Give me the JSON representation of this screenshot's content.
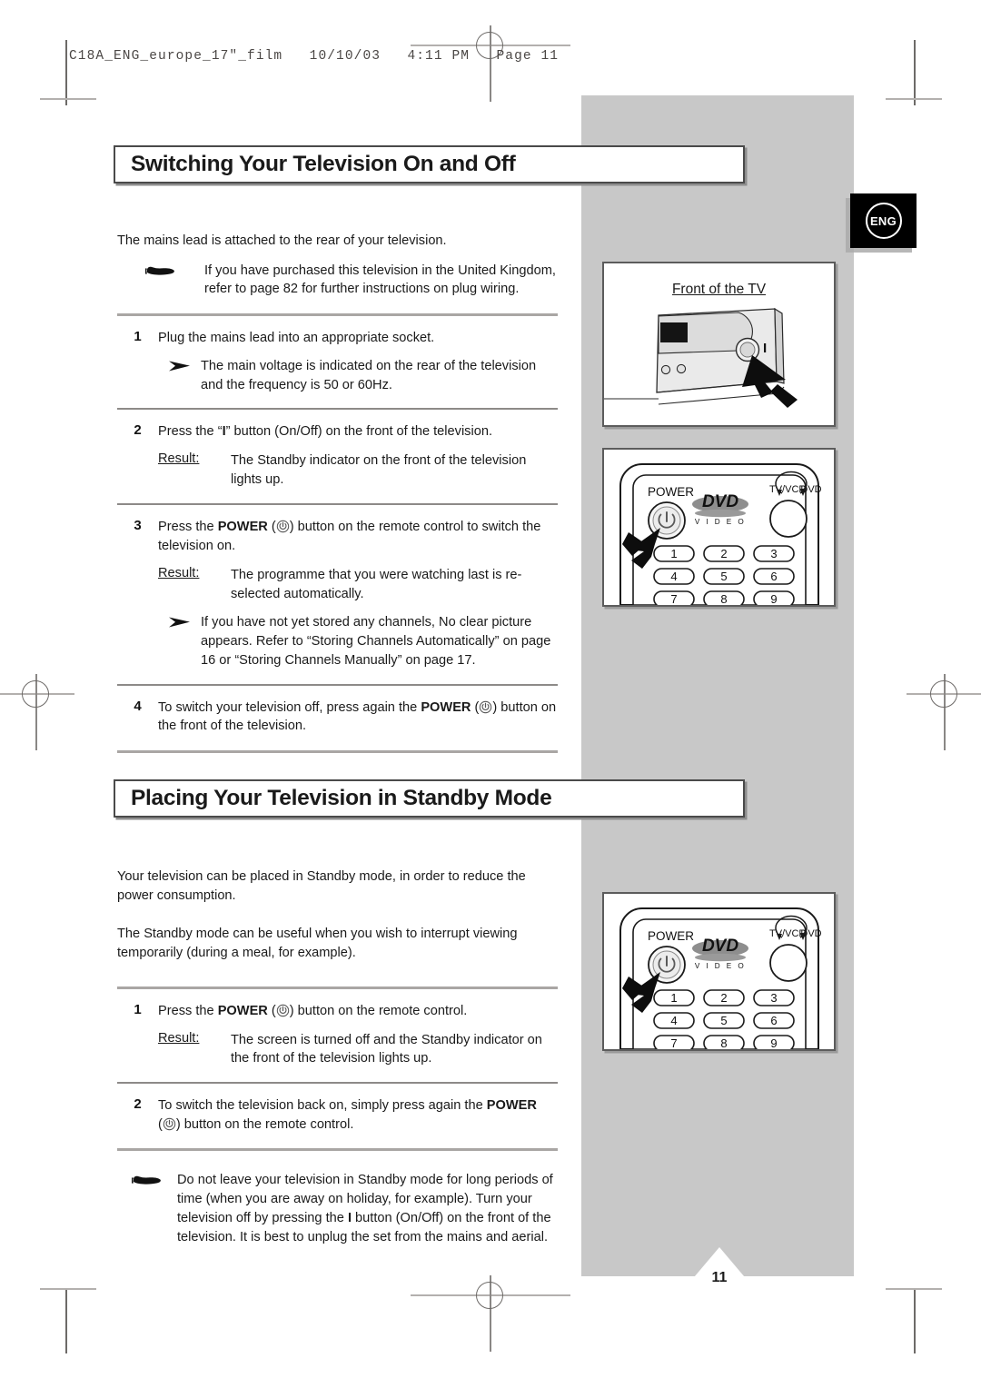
{
  "print": {
    "file_header": "C18A_ENG_europe_17\"_film   10/10/03   4:11 PM   Page 11"
  },
  "language_badge": {
    "label": "ENG",
    "bg": "#000000",
    "fg": "#ffffff"
  },
  "page_number": "11",
  "theme": {
    "band_grey": "#c8c8c8",
    "rule_grey": "#a9a6a4",
    "ink": "#1a1a1a"
  },
  "sections": [
    {
      "id": "switching-on-off",
      "title": "Switching Your Television On and Off",
      "intro": "The mains lead is attached to the rear of your television.",
      "hand_note": "If you have purchased this television in the United Kingdom, refer to page 82 for further instructions on plug wiring.",
      "steps": [
        {
          "num": "1",
          "text": "Plug the mains lead into an appropriate socket.",
          "arrow_note": "The main voltage is indicated on the rear of the television and the frequency is 50 or 60Hz."
        },
        {
          "num": "2",
          "text_pre": "Press the “",
          "text_key": "I",
          "text_post": "” button (On/Off) on the front of the television.",
          "result_label": "Result:",
          "result_text": "The Standby indicator on the front of the television lights up."
        },
        {
          "num": "3",
          "text_pre": "Press the ",
          "text_bold": "POWER",
          "text_post": ") button on the remote control to switch the television on.",
          "result_label": "Result:",
          "result_text": "The programme that you were watching last is re-selected automatically.",
          "arrow_note": "If you have not yet stored any channels, No clear picture appears. Refer to “Storing Channels Automatically” on page 16 or “Storing Channels Manually” on page 17."
        },
        {
          "num": "4",
          "text_pre": "To switch your television off, press again the ",
          "text_bold": "POWER",
          "text_post": ") button on the front of the television."
        }
      ]
    },
    {
      "id": "standby-mode",
      "title": "Placing Your Television in Standby Mode",
      "paragraphs": [
        "Your television can be placed in Standby mode, in order to reduce the power consumption.",
        "The Standby mode can be useful when you wish to interrupt viewing temporarily (during a meal, for example)."
      ],
      "steps": [
        {
          "num": "1",
          "text_pre": "Press the ",
          "text_bold": "POWER",
          "text_post": ") button on the remote control.",
          "result_label": "Result:",
          "result_text": "The screen is turned off and the Standby indicator on the front of the television lights up."
        },
        {
          "num": "2",
          "text_pre": "To switch the television back on, simply press again the ",
          "text_bold": "POWER",
          "text_post": ") button on the remote control."
        }
      ],
      "hand_note_pre": "Do not leave your television in Standby mode for long periods of time (when you are away on holiday, for example). Turn your television off by pressing the ",
      "hand_note_key": "I",
      "hand_note_post": " button (On/Off) on the front of the television. It is best to unplug the set from the mains and aerial."
    }
  ],
  "illustrations": [
    {
      "id": "front-of-tv",
      "title": "Front of the TV",
      "kind": "tv-front"
    },
    {
      "id": "remote-top",
      "kind": "remote",
      "power_label": "POWER",
      "mode_left": "TV/VCR",
      "mode_right": "DVD",
      "logo_main": "DVD",
      "logo_sub": "V I D E O",
      "keys": [
        "1",
        "2",
        "3",
        "4",
        "5",
        "6",
        "7",
        "8",
        "9"
      ]
    },
    {
      "id": "remote-bottom",
      "kind": "remote",
      "power_label": "POWER",
      "mode_left": "TV/VCR",
      "mode_right": "DVD",
      "logo_main": "DVD",
      "logo_sub": "V I D E O",
      "keys": [
        "1",
        "2",
        "3",
        "4",
        "5",
        "6",
        "7",
        "8",
        "9"
      ]
    }
  ]
}
